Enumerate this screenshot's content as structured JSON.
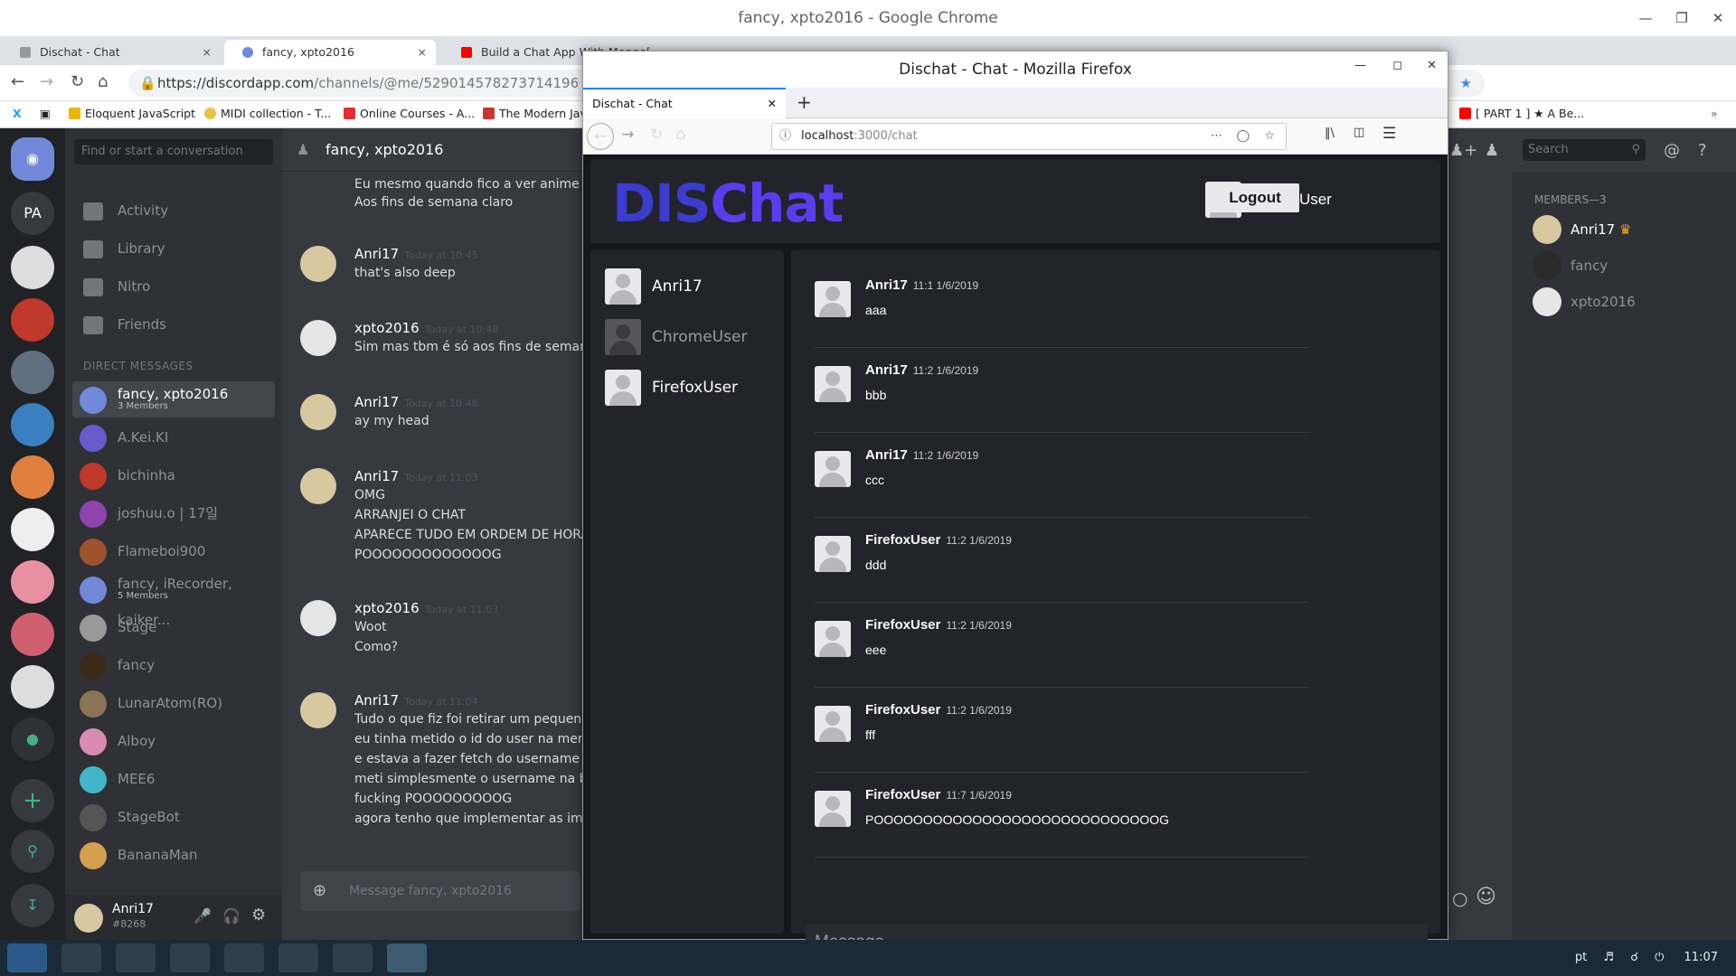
{
  "chrome": {
    "window_title": "fancy, xpto2016 - Google Chrome",
    "tabs": [
      {
        "label": "Dischat - Chat",
        "close": "×"
      },
      {
        "label": "fancy, xpto2016",
        "close": "×"
      },
      {
        "label": "Build a Chat App With Mongo[...]"
      }
    ],
    "url_host": "https://discordapp.com",
    "url_path": "/channels/@me/529014578273714196",
    "bookmarks": [
      "Eloquent JavaScript",
      "MIDI collection - T...",
      "Online Courses - A...",
      "The Modern Jav",
      "[ PART 1 ] ★ A Be..."
    ]
  },
  "discord": {
    "search_placeholder": "Find or start a conversation",
    "nav": [
      "Activity",
      "Library",
      "Nitro",
      "Friends"
    ],
    "dm_header": "DIRECT MESSAGES",
    "dms": [
      {
        "name": "fancy, xpto2016",
        "sub": "3 Members",
        "color": "#7289da"
      },
      {
        "name": "A.Kei.KI",
        "color": "#6a5acd"
      },
      {
        "name": "bichinha",
        "color": "#c0392b"
      },
      {
        "name": "joshuu.o | 17일",
        "color": "#8e44ad"
      },
      {
        "name": "Flameboi900",
        "color": "#a0522d"
      },
      {
        "name": "fancy, iRecorder, kaiker...",
        "sub": "5 Members",
        "color": "#7289da"
      },
      {
        "name": "Stage",
        "color": "#999"
      },
      {
        "name": "fancy",
        "color": "#3b2a1a"
      },
      {
        "name": "LunarAtom(RO)",
        "color": "#8b7355"
      },
      {
        "name": "Alboy",
        "color": "#d98cb3"
      },
      {
        "name": "MEE6",
        "color": "#43b5c9"
      },
      {
        "name": "StageBot",
        "color": "#555"
      },
      {
        "name": "BananaMan",
        "color": "#d4a04f"
      }
    ],
    "user_name": "Anri17",
    "user_tag": "#8268",
    "guild_label": "PA",
    "chat_title": "fancy, xpto2016",
    "messages_top": [
      "Eu mesmo quando fico a ver anime até t",
      "Aos fins de semana claro"
    ],
    "messages": [
      {
        "author": "Anri17",
        "time": "Today at 10:45",
        "lines": [
          "that's also deep"
        ]
      },
      {
        "author": "xpto2016",
        "time": "Today at 10:48",
        "lines": [
          "Sim mas tbm é só aos fins de semana"
        ]
      },
      {
        "author": "Anri17",
        "time": "Today at 10:48",
        "lines": [
          "ay my head"
        ]
      },
      {
        "author": "Anri17",
        "time": "Today at 11:03",
        "lines": [
          "OMG",
          "ARRANJEI O CHAT",
          "APARECE TUDO EM ORDEM DE HORA",
          "POOOOOOOOOOOOOG"
        ]
      },
      {
        "author": "xpto2016",
        "time": "Today at 11:03",
        "lines": [
          "Woot",
          "Como?"
        ]
      },
      {
        "author": "Anri17",
        "time": "Today at 11:04",
        "lines": [
          "Tudo o que fiz foi retirar um pequeno pa",
          "eu tinha metido o id do user na mensage",
          "e estava a fazer fetch do username com",
          "meti simplesmente o username na base",
          "fucking POOOOOOOOOG",
          "agora tenho que implementar as imagen"
        ]
      }
    ],
    "input_placeholder": "Message fancy, xpto2016",
    "search_right": "Search",
    "members_header": "MEMBERS—3",
    "members": [
      "Anri17",
      "fancy",
      "xpto2016"
    ]
  },
  "firefox": {
    "window_title": "Dischat - Chat - Mozilla Firefox",
    "tab_label": "Dischat - Chat",
    "url_host": "localhost",
    "url_rest": ":3000/chat",
    "app": {
      "logo_a": "DIS",
      "logo_b": "Chat",
      "current_user": "FirefoxUser",
      "logout_label": "Logout",
      "users": [
        "Anri17",
        "ChromeUser",
        "FirefoxUser"
      ],
      "messages": [
        {
          "author": "Anri17",
          "time": "11:1 1/6/2019",
          "text": "aaa"
        },
        {
          "author": "Anri17",
          "time": "11:2 1/6/2019",
          "text": "bbb"
        },
        {
          "author": "Anri17",
          "time": "11:2 1/6/2019",
          "text": "ccc"
        },
        {
          "author": "FirefoxUser",
          "time": "11:2 1/6/2019",
          "text": "ddd"
        },
        {
          "author": "FirefoxUser",
          "time": "11:2 1/6/2019",
          "text": "eee"
        },
        {
          "author": "FirefoxUser",
          "time": "11:2 1/6/2019",
          "text": "fff"
        },
        {
          "author": "FirefoxUser",
          "time": "11:7 1/6/2019",
          "text": "POOOOOOOOOOOOOOOOOOOOOOOOOOOOOG"
        }
      ],
      "input_placeholder": "Message"
    }
  },
  "taskbar": {
    "lang": "pt",
    "clock": "11:07"
  },
  "colors": {
    "discord_blurple": "#7289da",
    "logo_blue": "#3c3ccf",
    "logo_dark": "#23243a"
  }
}
